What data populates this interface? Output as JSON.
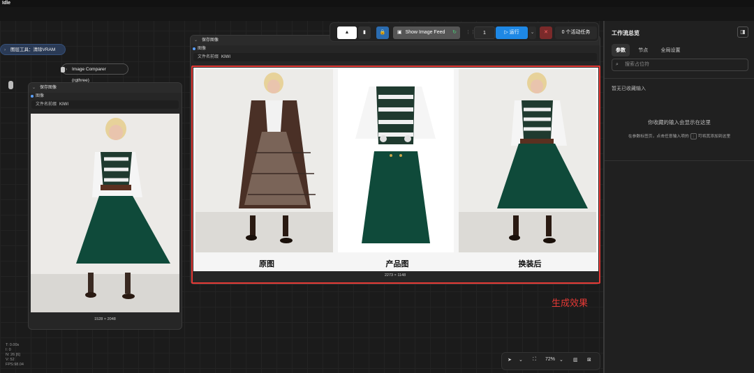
{
  "window": {
    "title": "Idle"
  },
  "nodes": {
    "pill_blue": {
      "label": "图层工具：清除VRAM"
    },
    "pill_dark": {
      "label": "Image Comparer (rgthree)"
    },
    "small_save": {
      "title": "保存图像",
      "port_label": "图像",
      "prefix_label": "文件名前缀",
      "prefix_value": "KIWI",
      "size": "1528 × 2048"
    },
    "main_save": {
      "title": "保存图像",
      "port_label": "图像",
      "prefix_label": "文件名前缀",
      "prefix_value": "KIWI",
      "size": "2273 × 1148",
      "captions": [
        "原图",
        "产品图",
        "换装后"
      ]
    }
  },
  "toolbar": {
    "feed_label": "Show Image Feed",
    "queue_count": "1",
    "run_label": "运行",
    "tasks_label": "0 个活动任务"
  },
  "annotation": {
    "text": "生成效果"
  },
  "stats": [
    "T: 0.00s",
    "I: 0",
    "N: 26 [6]",
    "V: 52",
    "FPS:98.04"
  ],
  "bottom_controls": {
    "zoom": "72%"
  },
  "right_panel": {
    "title": "工作流总览",
    "tabs": [
      "参数",
      "节点",
      "全局设置"
    ],
    "search_placeholder": "搜索占位符",
    "no_favorites": "暂无已收藏输入",
    "empty_title": "你收藏的输入会显示在这里",
    "hint_before": "在参数标签页，点击任意输入项的",
    "hint_after": "可将其添加到这里"
  },
  "colors": {
    "accent_blue": "#1e88e5",
    "highlight_red": "#e53935",
    "skirt_green": "#0f4a3a"
  }
}
